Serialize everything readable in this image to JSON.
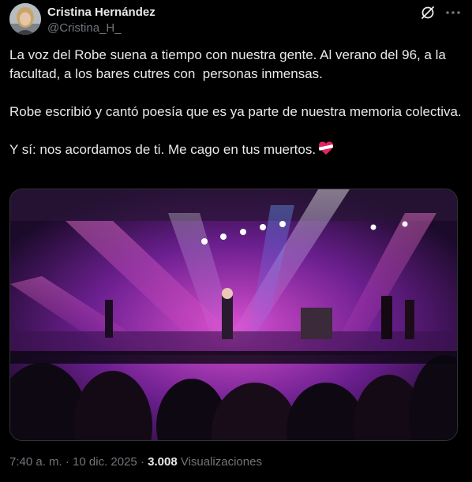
{
  "author": {
    "display_name": "Cristina Hernández",
    "handle": "@Cristina_H_"
  },
  "tweet": {
    "paragraph_1": "La voz del Robe suena a tiempo con nuestra gente. Al verano del 96, a la facultad, a los bares cutres con  personas inmensas.",
    "paragraph_2": "Robe escribió y cantó poesía que es ya parte de nuestra memoria colectiva.",
    "paragraph_3": "Y sí: nos acordamos de ti. Me cago en tus muertos."
  },
  "meta": {
    "time": "7:40 a. m.",
    "separator_1": " · ",
    "date": "10 dic. 2025",
    "separator_2": " · ",
    "views_count": "3.008",
    "views_label": " Visualizaciones"
  },
  "icons": {
    "grok": "grok-icon",
    "more": "more-icon",
    "heart": "heart-bandaged-icon"
  },
  "colors": {
    "background": "#000000",
    "text": "#e7e9ea",
    "secondary": "#71767b",
    "heart": "#e0245e"
  }
}
